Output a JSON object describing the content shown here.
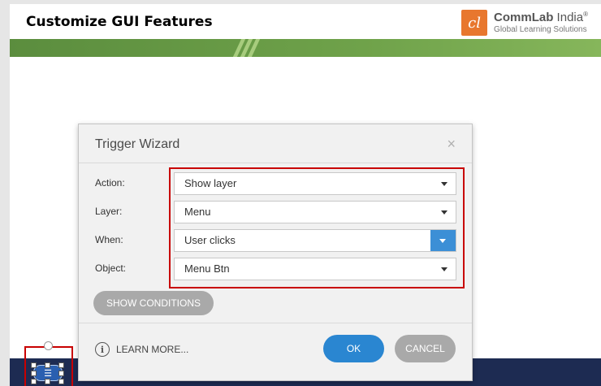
{
  "slide": {
    "title": "Customize GUI Features",
    "logo": {
      "name_bold": "CommLab",
      "name_rest": " India",
      "reg": "®",
      "tagline": "Global Learning Solutions",
      "mark": "cl"
    }
  },
  "dialog": {
    "title": "Trigger Wizard",
    "close_glyph": "×",
    "fields": [
      {
        "label": "Action:",
        "value": "Show layer"
      },
      {
        "label": "Layer:",
        "value": "Menu"
      },
      {
        "label": "When:",
        "value": "User clicks"
      },
      {
        "label": "Object:",
        "value": "Menu Btn"
      }
    ],
    "show_conditions_label": "SHOW CONDITIONS",
    "learn_more_label": "LEARN MORE...",
    "info_glyph": "i",
    "ok_label": "OK",
    "cancel_label": "CANCEL"
  },
  "menu_button_glyph": "☰",
  "colors": {
    "accent": "#2a86d1",
    "highlight": "#c80000",
    "green_band": "#6fa24a",
    "navy_band": "#1d2b52"
  }
}
